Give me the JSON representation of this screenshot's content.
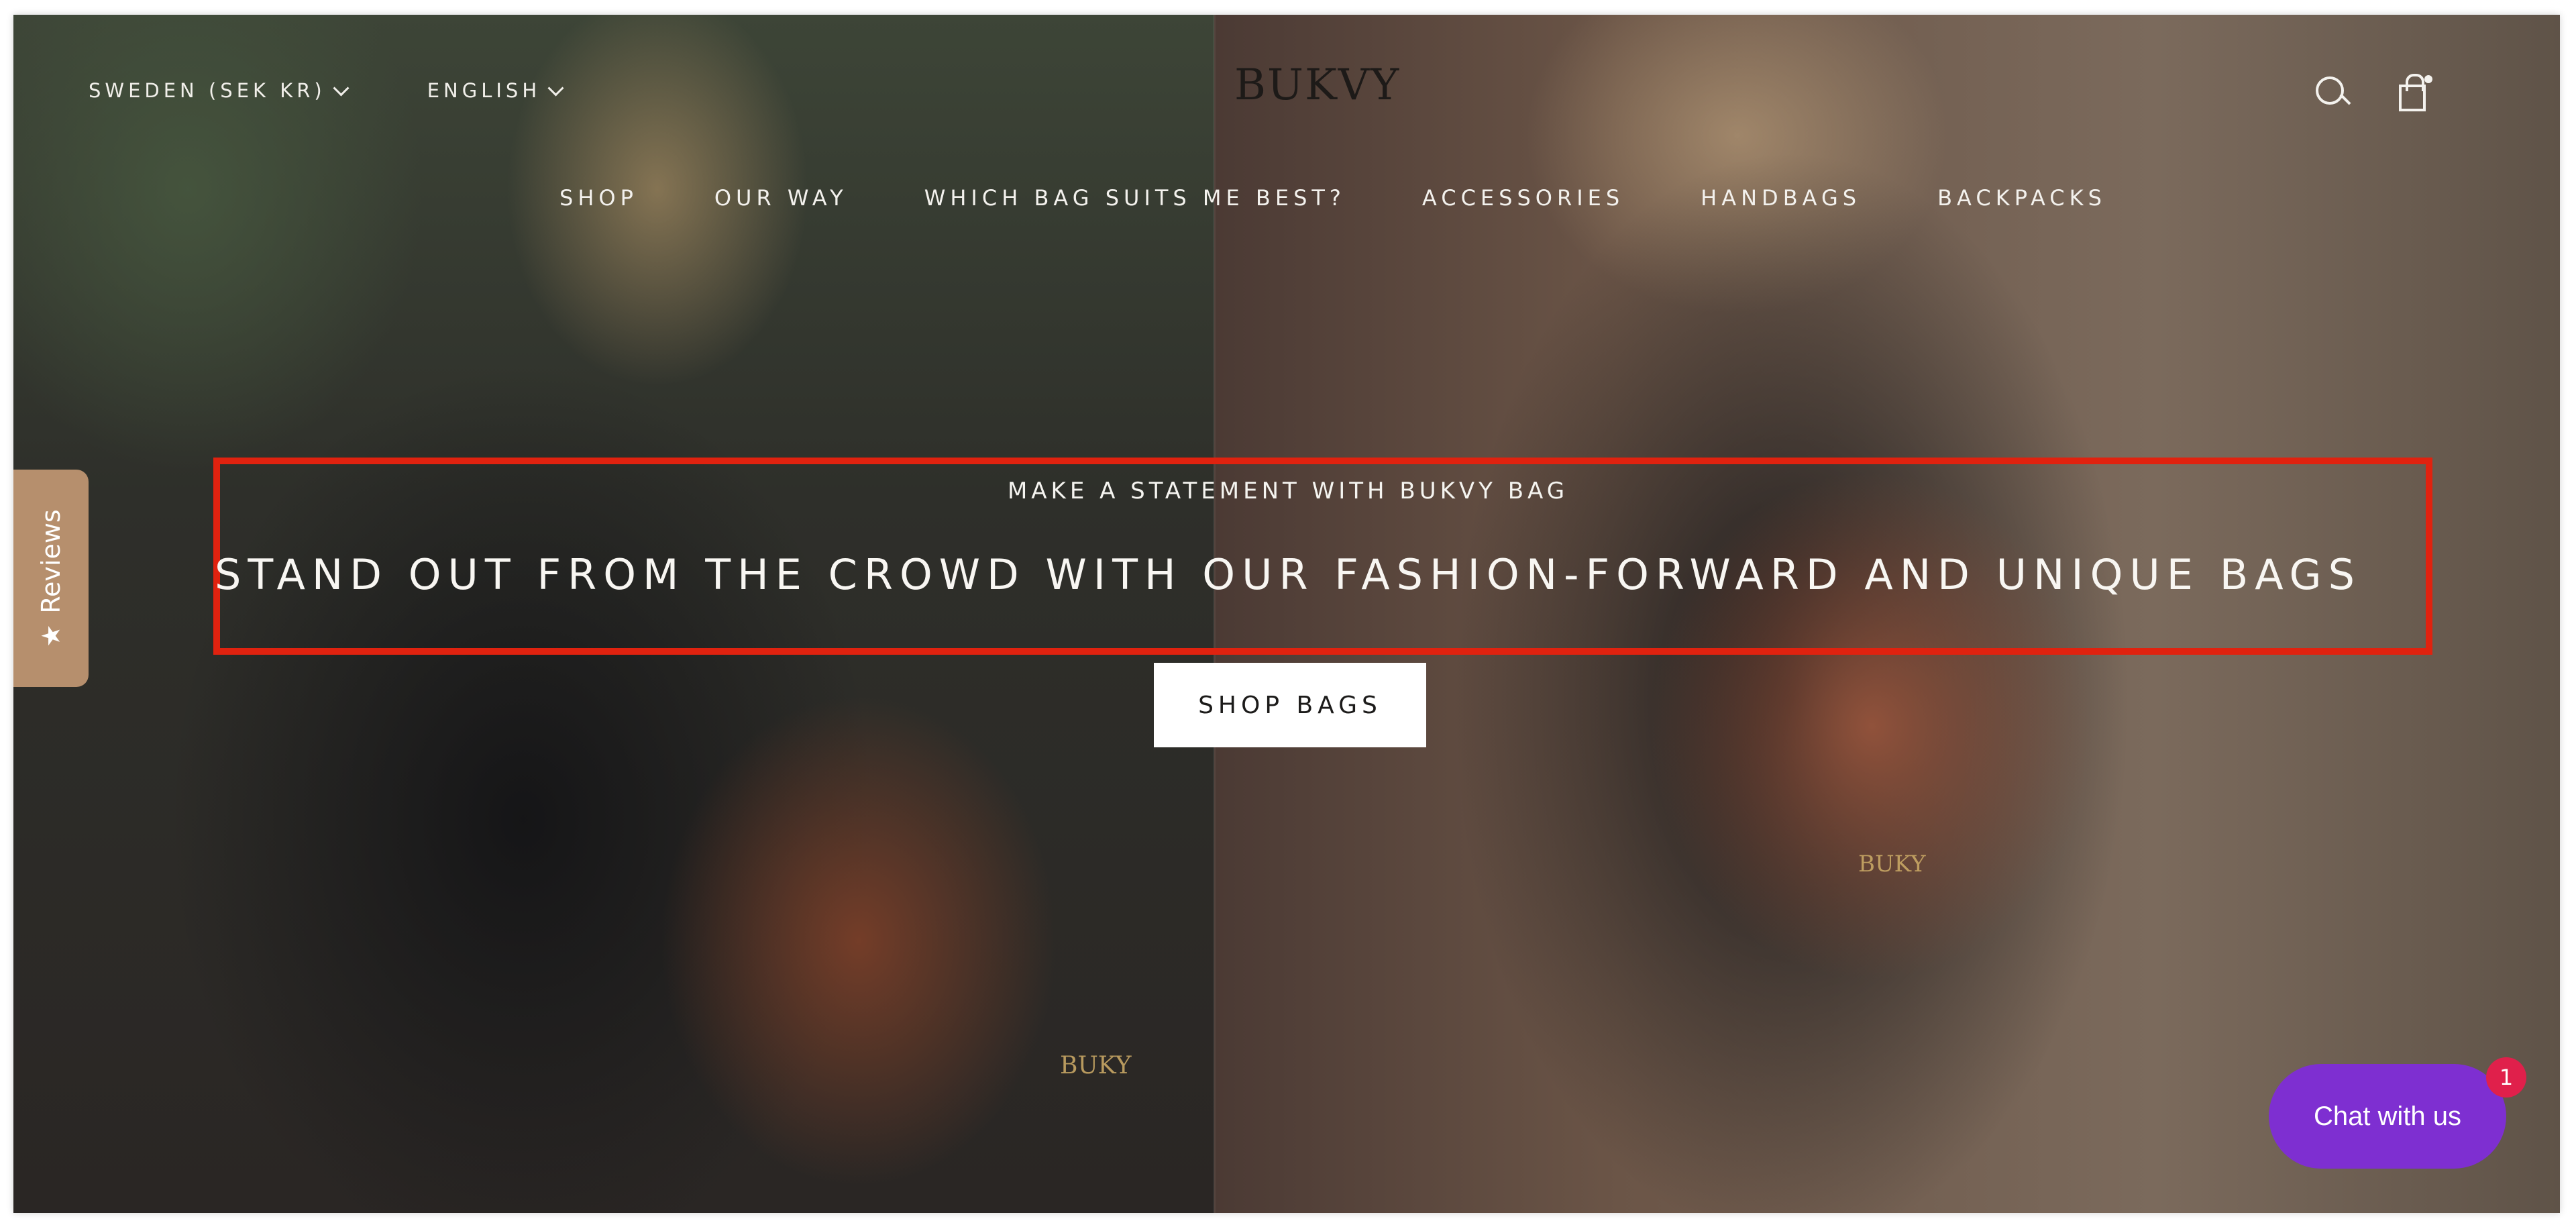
{
  "header": {
    "country_selector": "SWEDEN (SEK KR)",
    "language_selector": "ENGLISH",
    "logo": "BUKVY",
    "icons": [
      "search-icon",
      "cart-icon"
    ]
  },
  "nav": {
    "items": [
      {
        "label": "SHOP"
      },
      {
        "label": "OUR WAY"
      },
      {
        "label": "WHICH BAG SUITS ME BEST?"
      },
      {
        "label": "ACCESSORIES"
      },
      {
        "label": "HANDBAGS"
      },
      {
        "label": "BACKPACKS"
      }
    ]
  },
  "hero": {
    "subheading": "MAKE A STATEMENT WITH BUKVY BAG",
    "headline": "STAND OUT FROM THE CROWD WITH OUR FASHION-FORWARD AND UNIQUE BAGS",
    "cta": "SHOP BAGS",
    "product_marks": [
      "BUKY",
      "BUKY"
    ]
  },
  "reviews_tab": {
    "label": "Reviews"
  },
  "chat": {
    "label": "Chat with us",
    "badge": "1"
  },
  "colors": {
    "highlight": "#e0220f",
    "chat_bg": "#7e2fd1",
    "badge_bg": "#e0204b",
    "reviews_bg": "#b68f6d"
  }
}
